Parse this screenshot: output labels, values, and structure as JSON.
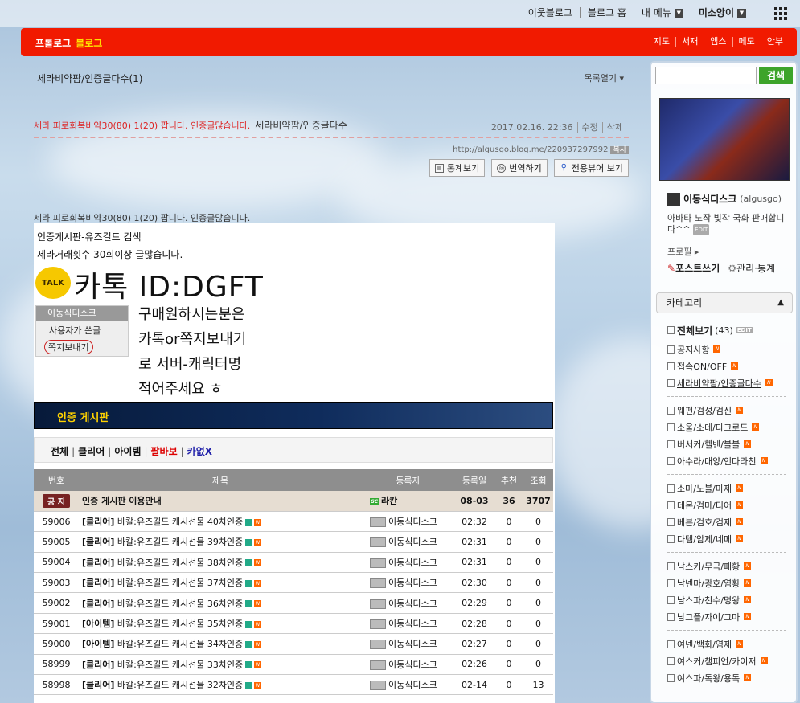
{
  "topnav": {
    "neighbor": "이웃블로그",
    "blog_home": "블로그 홈",
    "my_menu": "내 메뉴",
    "user": "미소앙이"
  },
  "redbar": {
    "logo_left": "프롤로그",
    "logo_right": "블로그",
    "menu": [
      "지도",
      "서재",
      "앱스",
      "메모",
      "안부"
    ]
  },
  "post": {
    "category_header": "세라비약팜/인증글다수(1)",
    "list_open": "목록열기",
    "title": "세라 피로회복비약30(80) 1(20) 팝니다. 인증글많습니다.",
    "category": "세라비약팜/인증글다수",
    "date": "2017.02.16. 22:36",
    "edit": "수정",
    "delete": "삭제",
    "url": "http://algusgo.blog.me/220937297992",
    "copy": "복사",
    "buttons": [
      "통계보기",
      "번역하기",
      "전용뷰어 보기"
    ],
    "lead": "세라 피로회복비약30(80) 1(20) 팝니다. 인증글많습니다."
  },
  "content": {
    "line1": "인증게시판-유즈길드 검색",
    "line2": "세라거래횟수 30회이상 글많습니다.",
    "talk": "TALK",
    "kakao": "카톡 ID:DGFT",
    "popup": {
      "name": "이동식디스크",
      "item1": "사용자가 쓴글",
      "item2": "쪽지보내기"
    },
    "buy_lines": [
      "구매원하시는분은",
      "카톡or쪽지보내기",
      "로 서버-캐릭터명",
      "적어주세요 ㅎ"
    ],
    "banner": "인증 게시판",
    "filters": [
      "전체",
      "클리어",
      "아이템",
      "팔바보",
      "카없X"
    ],
    "table": {
      "headers": [
        "번호",
        "제목",
        "등록자",
        "등록일",
        "추천",
        "조회"
      ],
      "notice": {
        "badge": "공 지",
        "title": "인증 게시판 이용안내",
        "author": "라칸",
        "date": "08-03",
        "rec": "36",
        "views": "3707"
      },
      "rows": [
        [
          "59006",
          "[클리어]",
          "바칼:유즈길드 캐시선물 40차인증",
          "이동식디스크",
          "02:32",
          "0",
          "0"
        ],
        [
          "59005",
          "[클리어]",
          "바칼:유즈길드 캐시선물 39차인증",
          "이동식디스크",
          "02:31",
          "0",
          "0"
        ],
        [
          "59004",
          "[클리어]",
          "바칼:유즈길드 캐시선물 38차인증",
          "이동식디스크",
          "02:31",
          "0",
          "0"
        ],
        [
          "59003",
          "[클리어]",
          "바칼:유즈길드 캐시선물 37차인증",
          "이동식디스크",
          "02:30",
          "0",
          "0"
        ],
        [
          "59002",
          "[클리어]",
          "바칼:유즈길드 캐시선물 36차인증",
          "이동식디스크",
          "02:29",
          "0",
          "0"
        ],
        [
          "59001",
          "[아이템]",
          "바칼:유즈길드 캐시선물 35차인증",
          "이동식디스크",
          "02:28",
          "0",
          "0"
        ],
        [
          "59000",
          "[아이템]",
          "바칼:유즈길드 캐시선물 34차인증",
          "이동식디스크",
          "02:27",
          "0",
          "0"
        ],
        [
          "58999",
          "[클리어]",
          "바칼:유즈길드 캐시선물 33차인증",
          "이동식디스크",
          "02:26",
          "0",
          "0"
        ],
        [
          "58998",
          "[클리어]",
          "바칼:유즈길드 캐시선물 32차인증",
          "이동식디스크",
          "02-14",
          "0",
          "13"
        ]
      ]
    }
  },
  "sidebar": {
    "search_btn": "검색",
    "profile_name": "이동식디스크",
    "profile_id": "(algusgo)",
    "profile_desc": "아바타 노작 빛작 국화 판매합니다^^",
    "edit": "EDIT",
    "profile_link": "프로필",
    "post_write": "포스트쓰기",
    "manage": "관리·통계",
    "category_header": "카테고리",
    "all": "전체보기",
    "all_count": "(43)",
    "cats1": [
      "공지사항",
      "접속ON/OFF",
      "세라비약팜/인증글다수"
    ],
    "cats2": [
      "웨펀/검성/검신",
      "소울/소테/다크로드",
      "버서커/헬벤/블블",
      "아수라/대양/인다라천"
    ],
    "cats3": [
      "소마/노블/마제",
      "데몬/검마/디어",
      "베븐/검호/검제",
      "다템/암제/네메"
    ],
    "cats4": [
      "남스커/무극/패황",
      "남넨마/광호/염황",
      "남스파/천수/명왕",
      "남그플/자이/그마"
    ],
    "cats5": [
      "여넨/백화/염제",
      "여스커/챔피언/카이저",
      "여스파/독왕/용독"
    ]
  }
}
